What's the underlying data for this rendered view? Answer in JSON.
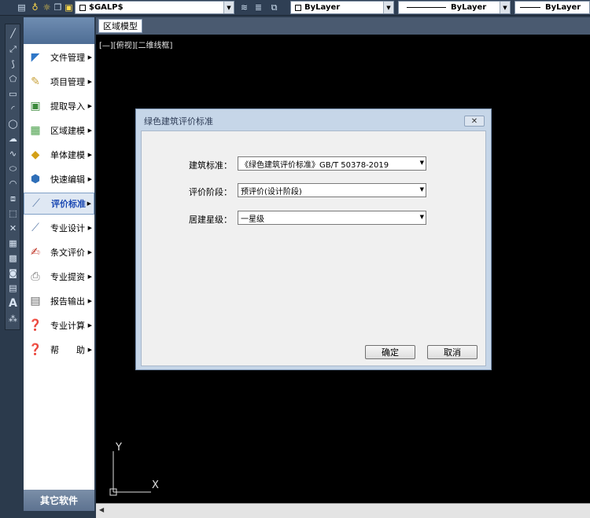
{
  "toolbar": {
    "layer_name": "$GALP$",
    "color": "ByLayer",
    "linetype": "ByLayer",
    "lineweight": "ByLayer"
  },
  "sidebar": {
    "items": [
      {
        "label": "文件管理",
        "icon": "folder-icon"
      },
      {
        "label": "项目管理",
        "icon": "notepad-icon"
      },
      {
        "label": "提取导入",
        "icon": "import-icon"
      },
      {
        "label": "区域建模",
        "icon": "map-icon"
      },
      {
        "label": "单体建模",
        "icon": "cube-icon"
      },
      {
        "label": "快速编辑",
        "icon": "box-icon"
      },
      {
        "label": "评价标准",
        "icon": "standard-icon"
      },
      {
        "label": "专业设计",
        "icon": "design-icon"
      },
      {
        "label": "条文评价",
        "icon": "document-edit-icon"
      },
      {
        "label": "专业提资",
        "icon": "printer-icon"
      },
      {
        "label": "报告输出",
        "icon": "report-icon"
      },
      {
        "label": "专业计算",
        "icon": "cube-help-icon"
      },
      {
        "label": "帮　　助",
        "icon": "help-icon"
      }
    ],
    "active_index": 6,
    "footer": "其它软件"
  },
  "drawing": {
    "tab": "区域模型",
    "view_label": "[—][俯视][二维线框]",
    "ucs_x": "X",
    "ucs_y": "Y"
  },
  "dialog": {
    "title": "绿色建筑评价标准",
    "fields": [
      {
        "label": "建筑标准：",
        "value": "《绿色建筑评价标准》GB/T 50378-2019"
      },
      {
        "label": "评价阶段：",
        "value": "预评价(设计阶段)"
      },
      {
        "label": "居建星级：",
        "value": "一星级"
      }
    ],
    "ok_label": "确定",
    "cancel_label": "取消"
  }
}
